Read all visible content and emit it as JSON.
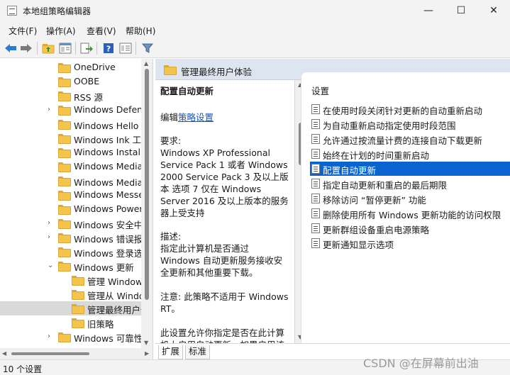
{
  "window": {
    "title": "本地组策略编辑器",
    "minimize": "—",
    "maximize": "☐",
    "close": "✕"
  },
  "menu": [
    "文件(F)",
    "操作(A)",
    "查看(V)",
    "帮助(H)"
  ],
  "toolbar": {
    "icons": [
      "back-icon",
      "forward-icon",
      "up-folder-icon",
      "show-hide-tree-icon",
      "export-list-icon",
      "help-icon",
      "properties-icon",
      "filter-icon"
    ]
  },
  "tree": {
    "items": [
      {
        "label": "OneDrive",
        "expandable": false,
        "indent": 1
      },
      {
        "label": "OOBE",
        "expandable": false,
        "indent": 1
      },
      {
        "label": "RSS 源",
        "expandable": false,
        "indent": 1
      },
      {
        "label": "Windows Defender",
        "expandable": true,
        "indent": 1
      },
      {
        "label": "Windows Hello 企业版",
        "expandable": false,
        "indent": 1
      },
      {
        "label": "Windows Ink 工作区",
        "expandable": false,
        "indent": 1
      },
      {
        "label": "Windows Installer",
        "expandable": false,
        "indent": 1
      },
      {
        "label": "Windows Media Player",
        "expandable": false,
        "indent": 1
      },
      {
        "label": "Windows Media 数字权限管理",
        "expandable": false,
        "indent": 1
      },
      {
        "label": "Windows Messenger",
        "expandable": false,
        "indent": 1
      },
      {
        "label": "Windows PowerShell",
        "expandable": false,
        "indent": 1
      },
      {
        "label": "Windows 安全中心",
        "expandable": true,
        "indent": 1
      },
      {
        "label": "Windows 错误报告",
        "expandable": true,
        "indent": 1
      },
      {
        "label": "Windows 登录选项",
        "expandable": false,
        "indent": 1
      },
      {
        "label": "Windows 更新",
        "expandable": true,
        "expanded": true,
        "indent": 1
      },
      {
        "label": "管理 Windows 更新",
        "expandable": false,
        "indent": 2
      },
      {
        "label": "管理从 Windows 更新",
        "expandable": false,
        "indent": 2
      },
      {
        "label": "管理最终用户体验",
        "expandable": false,
        "indent": 2,
        "selected": true
      },
      {
        "label": "旧策略",
        "expandable": false,
        "indent": 2
      },
      {
        "label": "Windows 可靠性",
        "expandable": true,
        "indent": 1
      }
    ]
  },
  "right": {
    "header": "管理最终用户体验",
    "description": {
      "policy_title": "配置自动更新",
      "edit_prefix": "编辑",
      "edit_link": "策略设置",
      "req_label": "要求:",
      "req_text": "Windows XP Professional Service Pack 1 或者 Windows 2000 Service Pack 3 及以上版本 选项 7 仅在 Windows Server 2016 及以上版本的服务器上受支持",
      "desc_label": "描述:",
      "desc_text": "指定此计算机是否通过 Windows 自动更新服务接收安全更新和其他重要下载。",
      "note_text": "注意: 此策略不适用于 Windows RT。",
      "more_text": "此设置允许你指定是否在此计算机上启用自动更新。如果启用该服"
    },
    "settings": {
      "header": "设置",
      "items": [
        "在使用时段关闭针对更新的自动重新启动",
        "为自动重新启动指定使用时段范围",
        "允许通过按流量计费的连接自动下载更新",
        "始终在计划的时间重新启动",
        "配置自动更新",
        "指定自动更新和重启的最后期限",
        "移除访问 “暂停更新” 功能",
        "删除使用所有 Windows 更新功能的访问权限",
        "更新群组设备重启电源策略",
        "更新通知显示选项"
      ],
      "selected_index": 4
    },
    "tabs": [
      "扩展",
      "标准"
    ]
  },
  "status": "10 个设置",
  "watermark": "CSDN @在屏幕前出油"
}
